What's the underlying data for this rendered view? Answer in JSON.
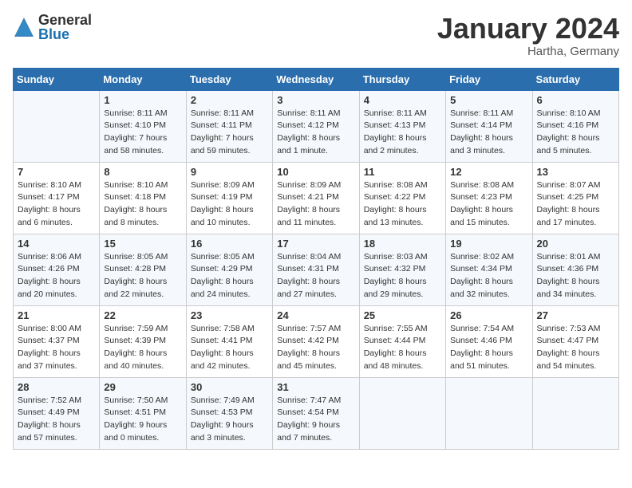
{
  "logo": {
    "general": "General",
    "blue": "Blue"
  },
  "title": "January 2024",
  "location": "Hartha, Germany",
  "weekdays": [
    "Sunday",
    "Monday",
    "Tuesday",
    "Wednesday",
    "Thursday",
    "Friday",
    "Saturday"
  ],
  "weeks": [
    [
      {
        "day": "",
        "sunrise": "",
        "sunset": "",
        "daylight": ""
      },
      {
        "day": "1",
        "sunrise": "Sunrise: 8:11 AM",
        "sunset": "Sunset: 4:10 PM",
        "daylight": "Daylight: 7 hours and 58 minutes."
      },
      {
        "day": "2",
        "sunrise": "Sunrise: 8:11 AM",
        "sunset": "Sunset: 4:11 PM",
        "daylight": "Daylight: 7 hours and 59 minutes."
      },
      {
        "day": "3",
        "sunrise": "Sunrise: 8:11 AM",
        "sunset": "Sunset: 4:12 PM",
        "daylight": "Daylight: 8 hours and 1 minute."
      },
      {
        "day": "4",
        "sunrise": "Sunrise: 8:11 AM",
        "sunset": "Sunset: 4:13 PM",
        "daylight": "Daylight: 8 hours and 2 minutes."
      },
      {
        "day": "5",
        "sunrise": "Sunrise: 8:11 AM",
        "sunset": "Sunset: 4:14 PM",
        "daylight": "Daylight: 8 hours and 3 minutes."
      },
      {
        "day": "6",
        "sunrise": "Sunrise: 8:10 AM",
        "sunset": "Sunset: 4:16 PM",
        "daylight": "Daylight: 8 hours and 5 minutes."
      }
    ],
    [
      {
        "day": "7",
        "sunrise": "Sunrise: 8:10 AM",
        "sunset": "Sunset: 4:17 PM",
        "daylight": "Daylight: 8 hours and 6 minutes."
      },
      {
        "day": "8",
        "sunrise": "Sunrise: 8:10 AM",
        "sunset": "Sunset: 4:18 PM",
        "daylight": "Daylight: 8 hours and 8 minutes."
      },
      {
        "day": "9",
        "sunrise": "Sunrise: 8:09 AM",
        "sunset": "Sunset: 4:19 PM",
        "daylight": "Daylight: 8 hours and 10 minutes."
      },
      {
        "day": "10",
        "sunrise": "Sunrise: 8:09 AM",
        "sunset": "Sunset: 4:21 PM",
        "daylight": "Daylight: 8 hours and 11 minutes."
      },
      {
        "day": "11",
        "sunrise": "Sunrise: 8:08 AM",
        "sunset": "Sunset: 4:22 PM",
        "daylight": "Daylight: 8 hours and 13 minutes."
      },
      {
        "day": "12",
        "sunrise": "Sunrise: 8:08 AM",
        "sunset": "Sunset: 4:23 PM",
        "daylight": "Daylight: 8 hours and 15 minutes."
      },
      {
        "day": "13",
        "sunrise": "Sunrise: 8:07 AM",
        "sunset": "Sunset: 4:25 PM",
        "daylight": "Daylight: 8 hours and 17 minutes."
      }
    ],
    [
      {
        "day": "14",
        "sunrise": "Sunrise: 8:06 AM",
        "sunset": "Sunset: 4:26 PM",
        "daylight": "Daylight: 8 hours and 20 minutes."
      },
      {
        "day": "15",
        "sunrise": "Sunrise: 8:05 AM",
        "sunset": "Sunset: 4:28 PM",
        "daylight": "Daylight: 8 hours and 22 minutes."
      },
      {
        "day": "16",
        "sunrise": "Sunrise: 8:05 AM",
        "sunset": "Sunset: 4:29 PM",
        "daylight": "Daylight: 8 hours and 24 minutes."
      },
      {
        "day": "17",
        "sunrise": "Sunrise: 8:04 AM",
        "sunset": "Sunset: 4:31 PM",
        "daylight": "Daylight: 8 hours and 27 minutes."
      },
      {
        "day": "18",
        "sunrise": "Sunrise: 8:03 AM",
        "sunset": "Sunset: 4:32 PM",
        "daylight": "Daylight: 8 hours and 29 minutes."
      },
      {
        "day": "19",
        "sunrise": "Sunrise: 8:02 AM",
        "sunset": "Sunset: 4:34 PM",
        "daylight": "Daylight: 8 hours and 32 minutes."
      },
      {
        "day": "20",
        "sunrise": "Sunrise: 8:01 AM",
        "sunset": "Sunset: 4:36 PM",
        "daylight": "Daylight: 8 hours and 34 minutes."
      }
    ],
    [
      {
        "day": "21",
        "sunrise": "Sunrise: 8:00 AM",
        "sunset": "Sunset: 4:37 PM",
        "daylight": "Daylight: 8 hours and 37 minutes."
      },
      {
        "day": "22",
        "sunrise": "Sunrise: 7:59 AM",
        "sunset": "Sunset: 4:39 PM",
        "daylight": "Daylight: 8 hours and 40 minutes."
      },
      {
        "day": "23",
        "sunrise": "Sunrise: 7:58 AM",
        "sunset": "Sunset: 4:41 PM",
        "daylight": "Daylight: 8 hours and 42 minutes."
      },
      {
        "day": "24",
        "sunrise": "Sunrise: 7:57 AM",
        "sunset": "Sunset: 4:42 PM",
        "daylight": "Daylight: 8 hours and 45 minutes."
      },
      {
        "day": "25",
        "sunrise": "Sunrise: 7:55 AM",
        "sunset": "Sunset: 4:44 PM",
        "daylight": "Daylight: 8 hours and 48 minutes."
      },
      {
        "day": "26",
        "sunrise": "Sunrise: 7:54 AM",
        "sunset": "Sunset: 4:46 PM",
        "daylight": "Daylight: 8 hours and 51 minutes."
      },
      {
        "day": "27",
        "sunrise": "Sunrise: 7:53 AM",
        "sunset": "Sunset: 4:47 PM",
        "daylight": "Daylight: 8 hours and 54 minutes."
      }
    ],
    [
      {
        "day": "28",
        "sunrise": "Sunrise: 7:52 AM",
        "sunset": "Sunset: 4:49 PM",
        "daylight": "Daylight: 8 hours and 57 minutes."
      },
      {
        "day": "29",
        "sunrise": "Sunrise: 7:50 AM",
        "sunset": "Sunset: 4:51 PM",
        "daylight": "Daylight: 9 hours and 0 minutes."
      },
      {
        "day": "30",
        "sunrise": "Sunrise: 7:49 AM",
        "sunset": "Sunset: 4:53 PM",
        "daylight": "Daylight: 9 hours and 3 minutes."
      },
      {
        "day": "31",
        "sunrise": "Sunrise: 7:47 AM",
        "sunset": "Sunset: 4:54 PM",
        "daylight": "Daylight: 9 hours and 7 minutes."
      },
      {
        "day": "",
        "sunrise": "",
        "sunset": "",
        "daylight": ""
      },
      {
        "day": "",
        "sunrise": "",
        "sunset": "",
        "daylight": ""
      },
      {
        "day": "",
        "sunrise": "",
        "sunset": "",
        "daylight": ""
      }
    ]
  ]
}
